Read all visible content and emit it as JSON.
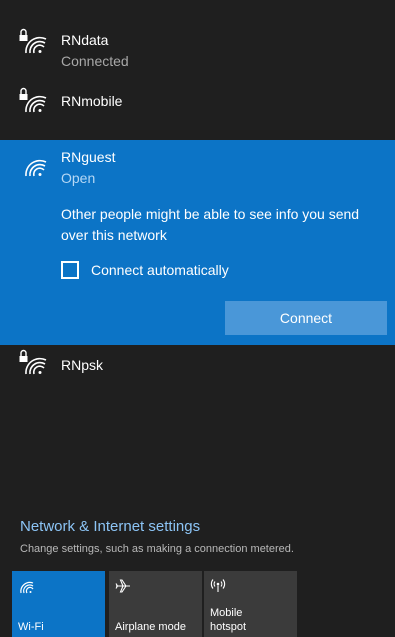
{
  "networks": [
    {
      "name": "RNdata",
      "status": "Connected",
      "icon": "wifi-secured-icon",
      "state": "connected"
    },
    {
      "name": "RNmobile",
      "icon": "wifi-secured-icon"
    },
    {
      "name": "RNguest",
      "status": "Open",
      "icon": "wifi-open-icon",
      "state": "selected"
    },
    {
      "name": "RNpsk",
      "icon": "wifi-secured-icon"
    }
  ],
  "selected_network": {
    "warning": "Other people might be able to see info you send over this network",
    "connect_automatically_label": "Connect automatically",
    "connect_automatically_checked": false,
    "connect_button_label": "Connect"
  },
  "settings": {
    "link": "Network & Internet settings",
    "description": "Change settings, such as making a connection metered."
  },
  "quick_actions": [
    {
      "label": "Wi-Fi",
      "icon": "wifi-icon",
      "active": true
    },
    {
      "label": "Airplane mode",
      "icon": "airplane-icon",
      "active": false
    },
    {
      "label": "Mobile\nhotspot",
      "icon": "hotspot-icon",
      "active": false
    }
  ],
  "colors": {
    "panel_background": "#1f1f1f",
    "accent": "#0c74c6",
    "connect_button": "#4a97d8",
    "link": "#8cc4f5",
    "inactive_tile": "#3b3b3b"
  }
}
